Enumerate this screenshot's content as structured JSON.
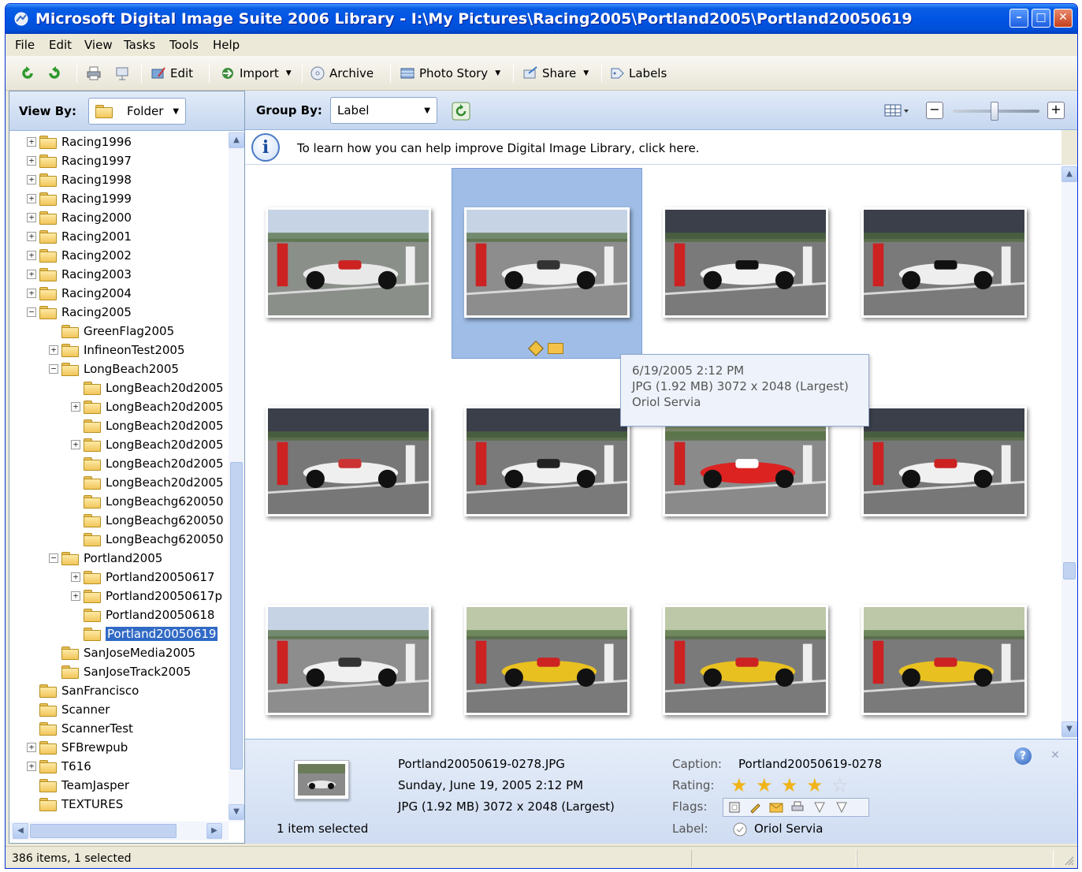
{
  "window": {
    "title": "Microsoft Digital Image Suite 2006 Library - I:\\My Pictures\\Racing2005\\Portland2005\\Portland20050619"
  },
  "menu": [
    "File",
    "Edit",
    "View",
    "Tasks",
    "Tools",
    "Help"
  ],
  "toolbar": {
    "edit": "Edit",
    "import": "Import",
    "archive": "Archive",
    "photo_story": "Photo Story",
    "share": "Share",
    "labels": "Labels"
  },
  "left": {
    "view_by_label": "View By:",
    "view_by_value": "Folder",
    "tree": [
      {
        "label": "Racing1996",
        "exp": "+"
      },
      {
        "label": "Racing1997",
        "exp": "+"
      },
      {
        "label": "Racing1998",
        "exp": "+"
      },
      {
        "label": "Racing1999",
        "exp": "+"
      },
      {
        "label": "Racing2000",
        "exp": "+"
      },
      {
        "label": "Racing2001",
        "exp": "+"
      },
      {
        "label": "Racing2002",
        "exp": "+"
      },
      {
        "label": "Racing2003",
        "exp": "+"
      },
      {
        "label": "Racing2004",
        "exp": "+"
      },
      {
        "label": "Racing2005",
        "exp": "-"
      },
      {
        "label": "GreenFlag2005",
        "exp": ""
      },
      {
        "label": "InfineonTest2005",
        "exp": "+"
      },
      {
        "label": "LongBeach2005",
        "exp": "-"
      },
      {
        "label": "LongBeach20d2005",
        "exp": ""
      },
      {
        "label": "LongBeach20d2005",
        "exp": "+"
      },
      {
        "label": "LongBeach20d2005",
        "exp": ""
      },
      {
        "label": "LongBeach20d2005",
        "exp": "+"
      },
      {
        "label": "LongBeach20d2005",
        "exp": ""
      },
      {
        "label": "LongBeach20d2005",
        "exp": ""
      },
      {
        "label": "LongBeachg620050",
        "exp": ""
      },
      {
        "label": "LongBeachg620050",
        "exp": ""
      },
      {
        "label": "LongBeachg620050",
        "exp": ""
      },
      {
        "label": "Portland2005",
        "exp": "-"
      },
      {
        "label": "Portland20050617",
        "exp": "+"
      },
      {
        "label": "Portland20050617p",
        "exp": "+"
      },
      {
        "label": "Portland20050618",
        "exp": ""
      },
      {
        "label": "Portland20050619",
        "exp": "",
        "selected": true
      },
      {
        "label": "SanJoseMedia2005",
        "exp": ""
      },
      {
        "label": "SanJoseTrack2005",
        "exp": ""
      },
      {
        "label": "SanFrancisco",
        "exp": ""
      },
      {
        "label": "Scanner",
        "exp": ""
      },
      {
        "label": "ScannerTest",
        "exp": ""
      },
      {
        "label": "SFBrewpub",
        "exp": "+"
      },
      {
        "label": "T616",
        "exp": "+"
      },
      {
        "label": "TeamJasper",
        "exp": ""
      },
      {
        "label": "TEXTURES",
        "exp": ""
      }
    ]
  },
  "main": {
    "group_by_label": "Group By:",
    "group_by_value": "Label",
    "info_message": "To learn how you can help improve Digital Image Library, click here.",
    "tooltip": {
      "line1": "6/19/2005 2:12 PM",
      "line2": "JPG (1.92 MB) 3072 x 2048 (Largest)",
      "line3": "Oriol Servia"
    }
  },
  "details": {
    "filename": "Portland20050619-0278.JPG",
    "date": "Sunday, June 19, 2005  2:12 PM",
    "fileinfo": "JPG (1.92 MB) 3072 x 2048 (Largest)",
    "selected_count": "1 item selected",
    "caption_label": "Caption:",
    "caption_value": "Portland20050619-0278",
    "rating_label": "Rating:",
    "rating": 4,
    "rating_max": 5,
    "flags_label": "Flags:",
    "label_label": "Label:",
    "label_value": "Oriol Servia"
  },
  "status": {
    "text": "386 items, 1 selected"
  },
  "colors": {
    "titlebar": "#0054e3",
    "selection": "#316ac5",
    "accent_blue": "#c5d6ef"
  }
}
